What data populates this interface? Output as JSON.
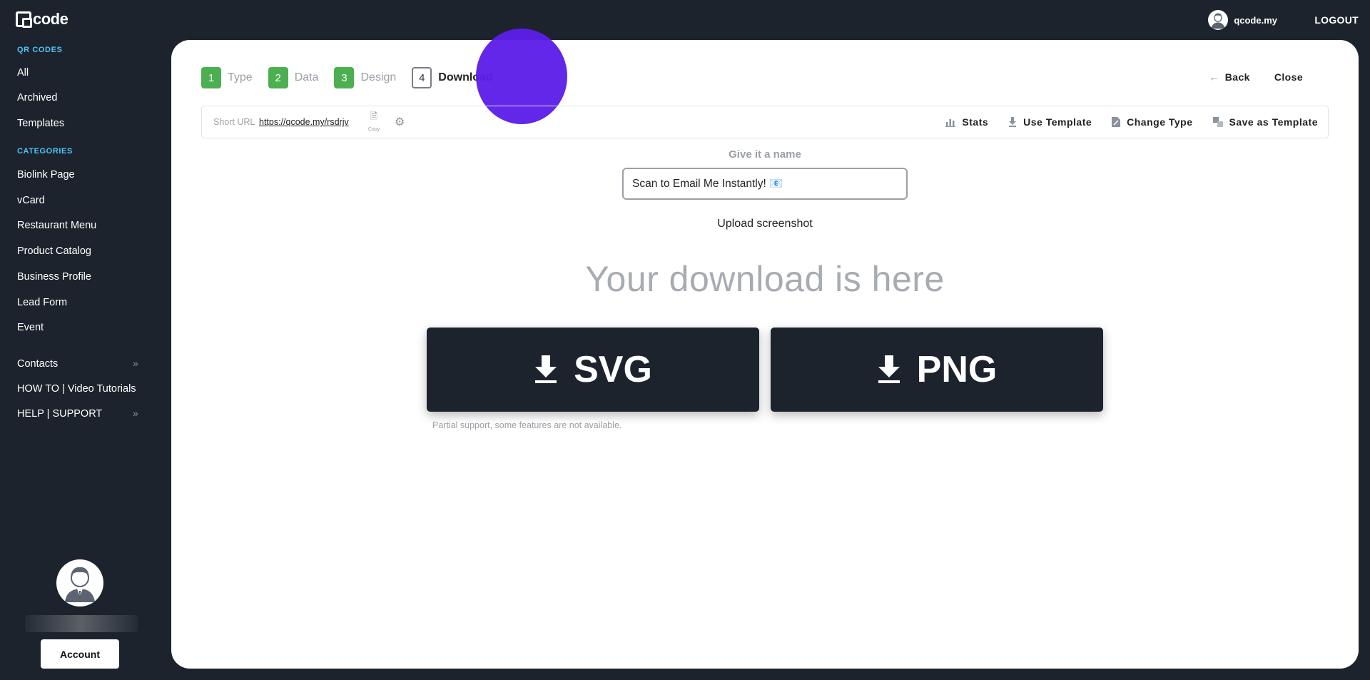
{
  "brand": {
    "logo_text": "code"
  },
  "header": {
    "username": "qcode.my",
    "logout_label": "LOGOUT"
  },
  "sidebar": {
    "qr_section": "QR CODES",
    "qr_items": [
      "All",
      "Archived",
      "Templates"
    ],
    "categories_section": "CATEGORIES",
    "category_items": [
      "Biolink Page",
      "vCard",
      "Restaurant Menu",
      "Product Catalog",
      "Business Profile",
      "Lead Form",
      "Event"
    ],
    "extra_items": [
      "Contacts",
      "HOW TO | Video Tutorials",
      "HELP | SUPPORT"
    ],
    "chevron_glyph": "»",
    "account_label": "Account"
  },
  "steps": [
    {
      "num": "1",
      "label": "Type"
    },
    {
      "num": "2",
      "label": "Data"
    },
    {
      "num": "3",
      "label": "Design"
    },
    {
      "num": "4",
      "label": "Download"
    }
  ],
  "top_actions": {
    "back_label": "Back",
    "close_label": "Close"
  },
  "urlbar": {
    "short_url_label": "Short URL",
    "short_url": "https://qcode.my/rsdrjv",
    "copy_label": "Copy",
    "tools": [
      "Stats",
      "Use Template",
      "Change Type",
      "Save as Template"
    ]
  },
  "name_section": {
    "label": "Give it a name",
    "value": "Scan to Email Me Instantly! 📧",
    "upload_label": "Upload screenshot"
  },
  "download": {
    "heading": "Your download is here",
    "svg_label": "SVG",
    "png_label": "PNG",
    "note": "Partial support, some features are not available."
  },
  "colors": {
    "sidebar_bg": "#1c232c",
    "accent_green": "#4caf50",
    "section_blue": "#4fc3f7",
    "cursor_purple": "#5c1ee8"
  }
}
